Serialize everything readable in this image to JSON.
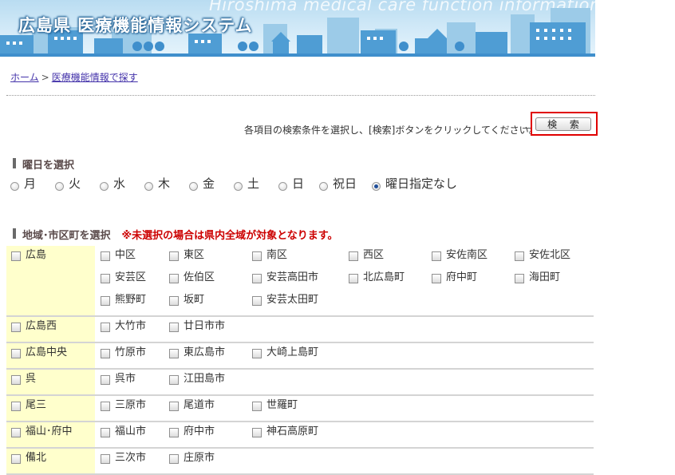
{
  "header": {
    "title": "広島県 医療機能情報システム",
    "subtitle_en": "Hiroshima medical care function information system"
  },
  "breadcrumb": {
    "home": "ホーム",
    "separator": ">",
    "current": "医療機能情報で探す"
  },
  "instruction": "各項目の検索条件を選択し、[検索]ボタンをクリックしてください。",
  "search_button": "検 索",
  "day_section": {
    "heading": "曜日を選択",
    "options": [
      "月",
      "火",
      "水",
      "木",
      "金",
      "土",
      "日",
      "祝日",
      "曜日指定なし"
    ],
    "selected_index": 8
  },
  "area_section": {
    "heading": "地域･市区町を選択",
    "warning": "※未選択の場合は県内全域が対象となります。",
    "regions": [
      {
        "name": "広島",
        "areas": [
          "中区",
          "東区",
          "南区",
          "西区",
          "安佐南区",
          "安佐北区",
          "安芸区",
          "佐伯区",
          "安芸高田市",
          "北広島町",
          "府中町",
          "海田町",
          "熊野町",
          "坂町",
          "安芸太田町"
        ]
      },
      {
        "name": "広島西",
        "areas": [
          "大竹市",
          "廿日市市"
        ]
      },
      {
        "name": "広島中央",
        "areas": [
          "竹原市",
          "東広島市",
          "大崎上島町"
        ]
      },
      {
        "name": "呉",
        "areas": [
          "呉市",
          "江田島市"
        ]
      },
      {
        "name": "尾三",
        "areas": [
          "三原市",
          "尾道市",
          "世羅町"
        ]
      },
      {
        "name": "福山･府中",
        "areas": [
          "福山市",
          "府中市",
          "神石高原町"
        ]
      },
      {
        "name": "備北",
        "areas": [
          "三次市",
          "庄原市"
        ]
      }
    ]
  },
  "colors": {
    "region_cell": "#ffffcc",
    "warning": "#cc0000",
    "link": "#4433aa",
    "highlight_frame": "#e00000"
  }
}
